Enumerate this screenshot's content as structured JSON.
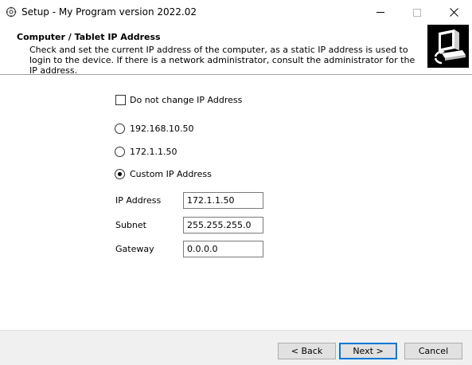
{
  "window": {
    "title": "Setup - My Program version 2022.02",
    "minimize_icon": "minimize-icon",
    "maximize_icon": "maximize-icon",
    "close_icon": "close-icon"
  },
  "header": {
    "title": "Computer / Tablet IP Address",
    "description": "Check and set the current IP address of the computer, as a static IP address is used to login to the device. If there is a network administrator, consult the administrator for the IP address.",
    "icon": "computer-setup-icon"
  },
  "options": {
    "no_change_label": "Do not change IP Address",
    "no_change_checked": false,
    "radios": [
      {
        "label": "192.168.10.50",
        "selected": false
      },
      {
        "label": "172.1.1.50",
        "selected": false
      },
      {
        "label": "Custom IP Address",
        "selected": true
      }
    ]
  },
  "fields": {
    "ip_label": "IP Address",
    "ip_value": "172.1.1.50",
    "subnet_label": "Subnet",
    "subnet_value": "255.255.255.0",
    "gateway_label": "Gateway",
    "gateway_value": "0.0.0.0"
  },
  "buttons": {
    "back": "< Back",
    "next": "Next >",
    "cancel": "Cancel"
  }
}
